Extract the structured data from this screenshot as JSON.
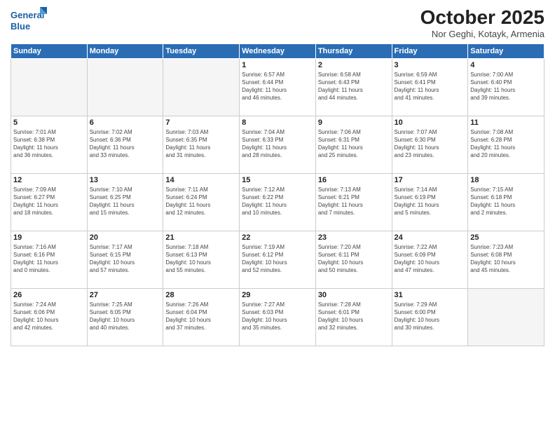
{
  "header": {
    "logo_line1": "General",
    "logo_line2": "Blue",
    "month": "October 2025",
    "location": "Nor Geghi, Kotayk, Armenia"
  },
  "weekdays": [
    "Sunday",
    "Monday",
    "Tuesday",
    "Wednesday",
    "Thursday",
    "Friday",
    "Saturday"
  ],
  "weeks": [
    [
      {
        "day": "",
        "info": ""
      },
      {
        "day": "",
        "info": ""
      },
      {
        "day": "",
        "info": ""
      },
      {
        "day": "1",
        "info": "Sunrise: 6:57 AM\nSunset: 6:44 PM\nDaylight: 11 hours\nand 46 minutes."
      },
      {
        "day": "2",
        "info": "Sunrise: 6:58 AM\nSunset: 6:43 PM\nDaylight: 11 hours\nand 44 minutes."
      },
      {
        "day": "3",
        "info": "Sunrise: 6:59 AM\nSunset: 6:41 PM\nDaylight: 11 hours\nand 41 minutes."
      },
      {
        "day": "4",
        "info": "Sunrise: 7:00 AM\nSunset: 6:40 PM\nDaylight: 11 hours\nand 39 minutes."
      }
    ],
    [
      {
        "day": "5",
        "info": "Sunrise: 7:01 AM\nSunset: 6:38 PM\nDaylight: 11 hours\nand 36 minutes."
      },
      {
        "day": "6",
        "info": "Sunrise: 7:02 AM\nSunset: 6:36 PM\nDaylight: 11 hours\nand 33 minutes."
      },
      {
        "day": "7",
        "info": "Sunrise: 7:03 AM\nSunset: 6:35 PM\nDaylight: 11 hours\nand 31 minutes."
      },
      {
        "day": "8",
        "info": "Sunrise: 7:04 AM\nSunset: 6:33 PM\nDaylight: 11 hours\nand 28 minutes."
      },
      {
        "day": "9",
        "info": "Sunrise: 7:06 AM\nSunset: 6:31 PM\nDaylight: 11 hours\nand 25 minutes."
      },
      {
        "day": "10",
        "info": "Sunrise: 7:07 AM\nSunset: 6:30 PM\nDaylight: 11 hours\nand 23 minutes."
      },
      {
        "day": "11",
        "info": "Sunrise: 7:08 AM\nSunset: 6:28 PM\nDaylight: 11 hours\nand 20 minutes."
      }
    ],
    [
      {
        "day": "12",
        "info": "Sunrise: 7:09 AM\nSunset: 6:27 PM\nDaylight: 11 hours\nand 18 minutes."
      },
      {
        "day": "13",
        "info": "Sunrise: 7:10 AM\nSunset: 6:25 PM\nDaylight: 11 hours\nand 15 minutes."
      },
      {
        "day": "14",
        "info": "Sunrise: 7:11 AM\nSunset: 6:24 PM\nDaylight: 11 hours\nand 12 minutes."
      },
      {
        "day": "15",
        "info": "Sunrise: 7:12 AM\nSunset: 6:22 PM\nDaylight: 11 hours\nand 10 minutes."
      },
      {
        "day": "16",
        "info": "Sunrise: 7:13 AM\nSunset: 6:21 PM\nDaylight: 11 hours\nand 7 minutes."
      },
      {
        "day": "17",
        "info": "Sunrise: 7:14 AM\nSunset: 6:19 PM\nDaylight: 11 hours\nand 5 minutes."
      },
      {
        "day": "18",
        "info": "Sunrise: 7:15 AM\nSunset: 6:18 PM\nDaylight: 11 hours\nand 2 minutes."
      }
    ],
    [
      {
        "day": "19",
        "info": "Sunrise: 7:16 AM\nSunset: 6:16 PM\nDaylight: 11 hours\nand 0 minutes."
      },
      {
        "day": "20",
        "info": "Sunrise: 7:17 AM\nSunset: 6:15 PM\nDaylight: 10 hours\nand 57 minutes."
      },
      {
        "day": "21",
        "info": "Sunrise: 7:18 AM\nSunset: 6:13 PM\nDaylight: 10 hours\nand 55 minutes."
      },
      {
        "day": "22",
        "info": "Sunrise: 7:19 AM\nSunset: 6:12 PM\nDaylight: 10 hours\nand 52 minutes."
      },
      {
        "day": "23",
        "info": "Sunrise: 7:20 AM\nSunset: 6:11 PM\nDaylight: 10 hours\nand 50 minutes."
      },
      {
        "day": "24",
        "info": "Sunrise: 7:22 AM\nSunset: 6:09 PM\nDaylight: 10 hours\nand 47 minutes."
      },
      {
        "day": "25",
        "info": "Sunrise: 7:23 AM\nSunset: 6:08 PM\nDaylight: 10 hours\nand 45 minutes."
      }
    ],
    [
      {
        "day": "26",
        "info": "Sunrise: 7:24 AM\nSunset: 6:06 PM\nDaylight: 10 hours\nand 42 minutes."
      },
      {
        "day": "27",
        "info": "Sunrise: 7:25 AM\nSunset: 6:05 PM\nDaylight: 10 hours\nand 40 minutes."
      },
      {
        "day": "28",
        "info": "Sunrise: 7:26 AM\nSunset: 6:04 PM\nDaylight: 10 hours\nand 37 minutes."
      },
      {
        "day": "29",
        "info": "Sunrise: 7:27 AM\nSunset: 6:03 PM\nDaylight: 10 hours\nand 35 minutes."
      },
      {
        "day": "30",
        "info": "Sunrise: 7:28 AM\nSunset: 6:01 PM\nDaylight: 10 hours\nand 32 minutes."
      },
      {
        "day": "31",
        "info": "Sunrise: 7:29 AM\nSunset: 6:00 PM\nDaylight: 10 hours\nand 30 minutes."
      },
      {
        "day": "",
        "info": ""
      }
    ]
  ]
}
